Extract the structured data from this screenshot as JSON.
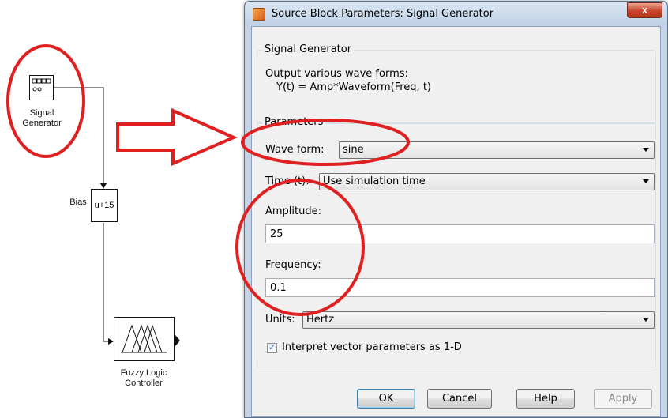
{
  "model": {
    "signal_generator": {
      "label_line1": "Signal",
      "label_line2": "Generator"
    },
    "bias": {
      "label": "Bias",
      "expression": "u+15"
    },
    "fuzzy": {
      "label_line1": "Fuzzy Logic",
      "label_line2": "Controller"
    }
  },
  "annotation_colors": {
    "circle": "#e02020",
    "arrow": "#e02020"
  },
  "dialog": {
    "title": "Source Block Parameters: Signal Generator",
    "close_glyph": "x",
    "block_group": {
      "title": "Signal Generator",
      "description_line1": "Output various wave forms:",
      "description_line2": "Y(t) = Amp*Waveform(Freq, t)"
    },
    "params_group": {
      "title": "Parameters",
      "wave_form": {
        "label": "Wave form:",
        "value": "sine"
      },
      "time": {
        "label": "Time (t):",
        "value": "Use simulation time"
      },
      "amplitude": {
        "label": "Amplitude:",
        "value": "25"
      },
      "frequency": {
        "label": "Frequency:",
        "value": "0.1"
      },
      "units": {
        "label": "Units:",
        "value": "Hertz"
      },
      "interpret": {
        "label": "Interpret vector parameters as 1-D",
        "checked": true,
        "check_glyph": "✓"
      }
    },
    "buttons": {
      "ok": "OK",
      "cancel": "Cancel",
      "help": "Help",
      "apply": "Apply"
    }
  }
}
